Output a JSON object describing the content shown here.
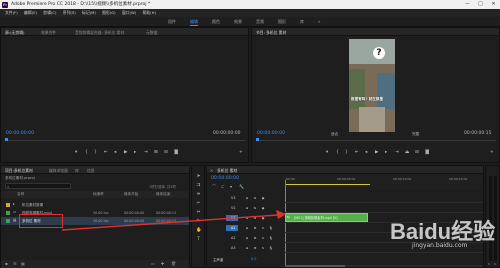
{
  "app": {
    "title": "Adobe Premiere Pro CC 2018 - D:\\\\15\\\\视频\\\\多机位素材.prproj *",
    "logo": "Pr"
  },
  "window_controls": [
    "—",
    "□",
    "✕"
  ],
  "menu": [
    "文件(F)",
    "编辑(E)",
    "剪辑(C)",
    "序列(S)",
    "标记(M)",
    "图形(G)",
    "窗口(W)",
    "帮助(H)"
  ],
  "workspaces": [
    "组件",
    "编辑",
    "颜色",
    "效果",
    "音频",
    "图形",
    "库",
    "»"
  ],
  "source_panel": {
    "tabs": [
      "源:(无剪辑)",
      "效果控件",
      "音频剪辑混合器: 多机位 素材",
      "元数据"
    ],
    "timecode_left": "00:00:00:00",
    "timecode_right": "00:00:00:00"
  },
  "program_panel": {
    "tab": "节目: 多机位 素材",
    "timecode_left": "00:00:00:00",
    "fit": "适合",
    "quality": "完整",
    "timecode_right": "00:00:00:15",
    "overlay_text": "那里有吗? 就在那里"
  },
  "project_panel": {
    "tabs": [
      "项目:多机位素材",
      "媒体浏览器",
      "库",
      "信息"
    ],
    "path": "多机位素材.prproj",
    "search_placeholder": "",
    "count": "1项已选择, 共3项",
    "columns": [
      "名称",
      "帧速率",
      "媒体开始",
      "媒体结束"
    ],
    "rows": [
      {
        "name": "机位素材剪辑",
        "fps": "",
        "start": "",
        "end": ""
      },
      {
        "name": "视频剪辑素材.mp4",
        "fps": "30.00 fps",
        "start": "00:00:00:00",
        "end": "00:00:00:15"
      },
      {
        "name": "多机位 素材",
        "fps": "30.00 fps",
        "start": "00:00:00:00",
        "end": "00:00:00:15"
      }
    ]
  },
  "timeline_panel": {
    "tab": "多机位 素材",
    "timecode": "00:00:00:00",
    "ruler_labels": [
      ":00:00",
      "00:00:05:00",
      "00:00:10:00",
      "00:00:15:00"
    ],
    "tracks": [
      "V3",
      "V2",
      "V1",
      "A1",
      "A2",
      "A3",
      "主声道"
    ],
    "master_value": "0.0",
    "clip_label": "[MC1] 视频剪辑素材.mp4 [V]"
  },
  "watermark": {
    "text": "Baidu经验",
    "sub": "jingyan.baidu.com"
  },
  "colors": {
    "accent": "#3d8ff0",
    "clip": "#55b04c",
    "arrow": "#e03030",
    "workspace_active": "#4a8ee6"
  }
}
